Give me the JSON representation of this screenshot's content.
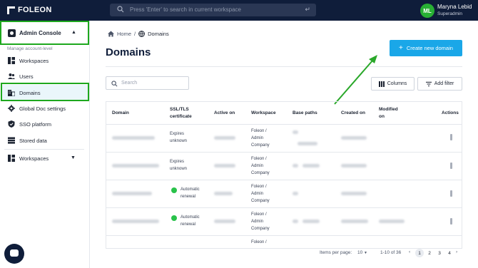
{
  "topbar": {
    "logo": "FOLEON",
    "search_placeholder": "Press 'Enter' to search in current workspace",
    "enter_glyph": "↵",
    "user_initials": "ML",
    "user_name": "Maryna Lebid",
    "user_role": "Superadmin"
  },
  "sidebar": {
    "admin_console": "Admin Console",
    "manage_label": "Manage account-level",
    "items": [
      {
        "label": "Workspaces",
        "icon": "grid-icon"
      },
      {
        "label": "Users",
        "icon": "users-icon"
      },
      {
        "label": "Domains",
        "icon": "domain-icon"
      },
      {
        "label": "Global Doc settings",
        "icon": "gear-icon"
      },
      {
        "label": "SSO platform",
        "icon": "shield-icon"
      },
      {
        "label": "Stored data",
        "icon": "database-icon"
      }
    ],
    "workspaces_group": "Workspaces"
  },
  "main": {
    "breadcrumb_home": "Home",
    "breadcrumb_sep": "/",
    "breadcrumb_current": "Domains",
    "title": "Domains",
    "create_button": "Create new domain",
    "search_placeholder": "Search",
    "columns_button": "Columns",
    "add_filter_button": "Add filter"
  },
  "table": {
    "headers": [
      "Domain",
      "SSL/TLS certificate",
      "Active on",
      "Workspace",
      "Base paths",
      "Created on",
      "Modified on",
      "Actions"
    ],
    "rows": [
      {
        "ssl": "Expires unknown",
        "workspace": "Foleon / Admin Company",
        "status": "none"
      },
      {
        "ssl": "Expires unknown",
        "workspace": "Foleon / Admin Company",
        "status": "none"
      },
      {
        "ssl": "Automatic renewal",
        "workspace": "Foleon / Admin Company",
        "status": "active"
      },
      {
        "ssl": "Automatic renewal",
        "workspace": "Foleon / Admin Company",
        "status": "active"
      },
      {
        "ssl": "",
        "workspace": "Foleon /",
        "status": "none"
      }
    ]
  },
  "pagination": {
    "items_label": "Items per page:",
    "per_page": "10",
    "range": "1-10 of 36",
    "pages": [
      "1",
      "2",
      "3",
      "4"
    ],
    "current": "1"
  },
  "colors": {
    "topbar": "#0f1d3a",
    "accent": "#1aa7e8",
    "highlight": "#1ea81e"
  }
}
